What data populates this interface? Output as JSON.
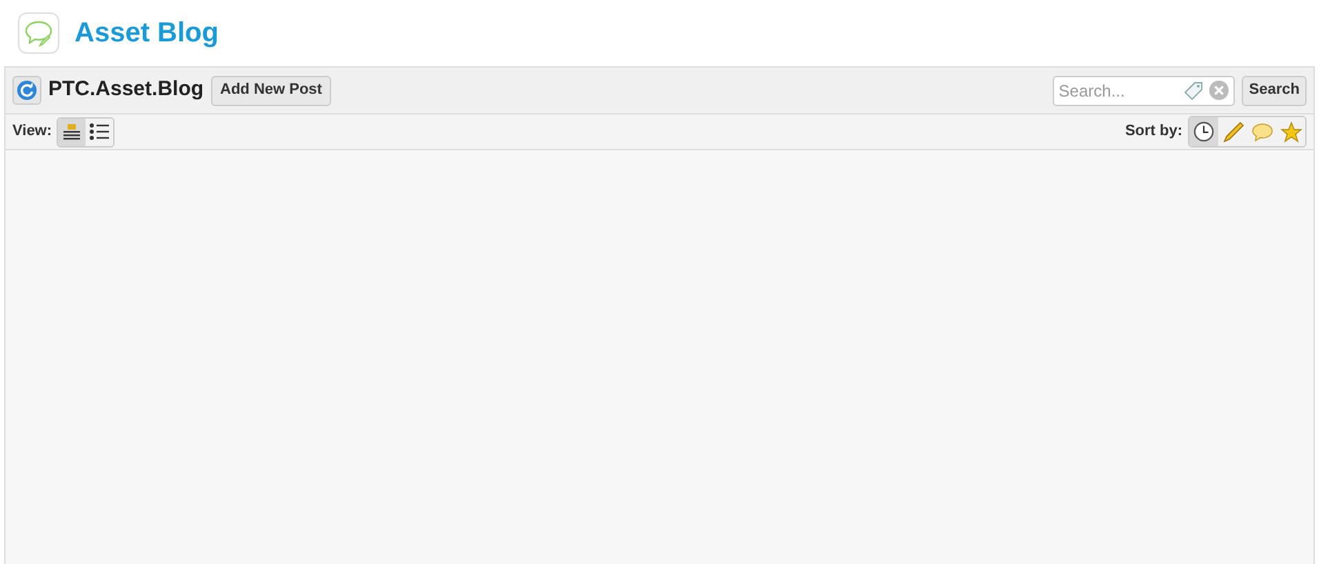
{
  "header": {
    "title": "Asset Blog"
  },
  "toolbar": {
    "title": "PTC.Asset.Blog",
    "add_button": "Add New Post",
    "search": {
      "placeholder": "Search..."
    },
    "search_button": "Search"
  },
  "view": {
    "label": "View:",
    "options": [
      {
        "kind": "full",
        "selected": true
      },
      {
        "kind": "list",
        "selected": false
      }
    ]
  },
  "sort": {
    "label": "Sort by:",
    "options": [
      {
        "kind": "date",
        "selected": true
      },
      {
        "kind": "author",
        "selected": false
      },
      {
        "kind": "comments",
        "selected": false
      },
      {
        "kind": "rating",
        "selected": false
      }
    ]
  }
}
